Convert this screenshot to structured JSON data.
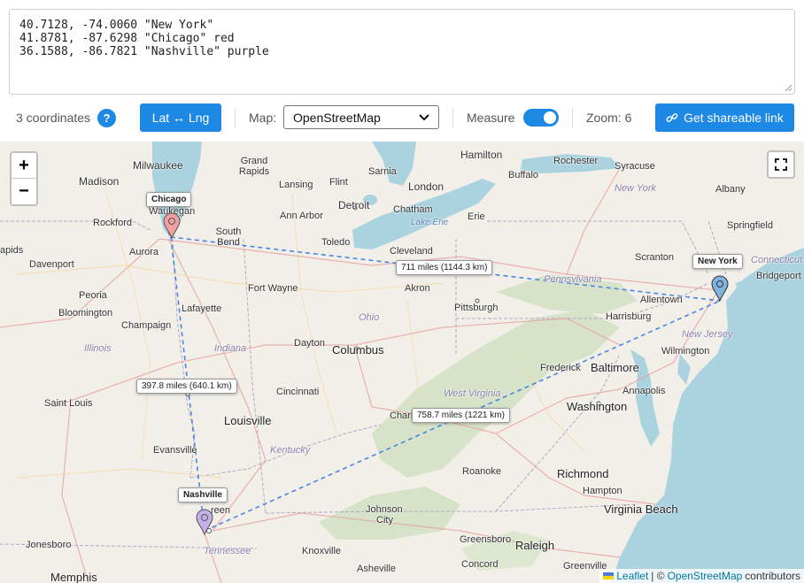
{
  "coordinates_input": {
    "text": "40.7128, -74.0060 \"New York\"\n41.8781, -87.6298 \"Chicago\" red\n36.1588, -86.7821 \"Nashville\" purple"
  },
  "toolbar": {
    "count_label": "3 coordinates",
    "help_icon": "?",
    "swap_label": "Lat ↔ Lng",
    "map_label": "Map:",
    "map_selected": "OpenStreetMap",
    "measure_label": "Measure",
    "measure_on": true,
    "zoom_label": "Zoom: 6",
    "share_label": "Get shareable link",
    "share_icon": "link-icon",
    "accent_color": "#1e88e5"
  },
  "map": {
    "zoom_in": "+",
    "zoom_out": "−",
    "fullscreen_icon": "fullscreen-icon",
    "markers": [
      {
        "name": "New York",
        "color": "#7fb3e0"
      },
      {
        "name": "Chicago",
        "color": "#f0a0a0"
      },
      {
        "name": "Nashville",
        "color": "#c4b0e8"
      }
    ],
    "distances": [
      {
        "label": "711 miles (1144.3 km)"
      },
      {
        "label": "397.8 miles (640.1 km)"
      },
      {
        "label": "758.7 miles (1221 km)"
      }
    ],
    "places": {
      "milwaukee": "Milwaukee",
      "madison": "Madison",
      "grand_rapids": "Grand Rapids",
      "lansing": "Lansing",
      "flint": "Flint",
      "sarnia": "Sarnia",
      "hamilton": "Hamilton",
      "rochester": "Rochester",
      "syracuse": "Syracuse",
      "london": "London",
      "buffalo": "Buffalo",
      "albany": "Albany",
      "new_york_state": "New York",
      "rockford": "Rockford",
      "ann_arbor": "Ann Arbor",
      "detroit": "Detroit",
      "chatham": "Chatham",
      "erie": "Erie",
      "springfield": "Springfield",
      "aurora": "Aurora",
      "south_bend": "South Bend",
      "toledo": "Toledo",
      "lake_erie": "Lake Erie",
      "davenport": "Davenport",
      "cleveland": "Cleveland",
      "scranton": "Scranton",
      "bridgeport": "Bridgeport",
      "apids": "apids",
      "fort_wayne": "Fort Wayne",
      "akron": "Akron",
      "pennsylvania": "Pennsylvania",
      "peoria": "Peoria",
      "pittsburgh": "Pittsburgh",
      "allentown": "Allentown",
      "connecticut": "Connecticut",
      "bloomington": "Bloomington",
      "lafayette": "Lafayette",
      "harrisburg": "Harrisburg",
      "ohio": "Ohio",
      "champaign": "Champaign",
      "dayton": "Dayton",
      "new_jersey": "New Jersey",
      "illinois": "Illinois",
      "indiana": "Indiana",
      "columbus": "Columbus",
      "wilmington": "Wilmington",
      "baltimore": "Baltimore",
      "frederick": "Frederick",
      "cincinnati": "Cincinnati",
      "annapolis": "Annapolis",
      "saint_louis": "Saint Louis",
      "west_virginia": "West Virginia",
      "washington": "Washington",
      "louisville": "Louisville",
      "charl": "Charl",
      "kentucky": "Kentucky",
      "evansville": "Evansville",
      "roanoke": "Roanoke",
      "richmond": "Richmond",
      "hampton": "Hampton",
      "virginia_beach": "Virginia Beach",
      "johnson_city": "Johnson",
      "city": "City",
      "greensboro": "Greensboro",
      "raleigh": "Raleigh",
      "jonesboro": "Jonesboro",
      "tennessee": "Tennessee",
      "knoxville": "Knoxville",
      "asheville": "Asheville",
      "concord": "Concord",
      "greenville": "Greenville",
      "memphis": "Memphis",
      "waukegan": "Waukegan",
      "reen": "reen"
    },
    "attribution": {
      "leaflet": "Leaflet",
      "separator": "| ©",
      "osm": "OpenStreetMap",
      "contributors": "contributors"
    }
  }
}
